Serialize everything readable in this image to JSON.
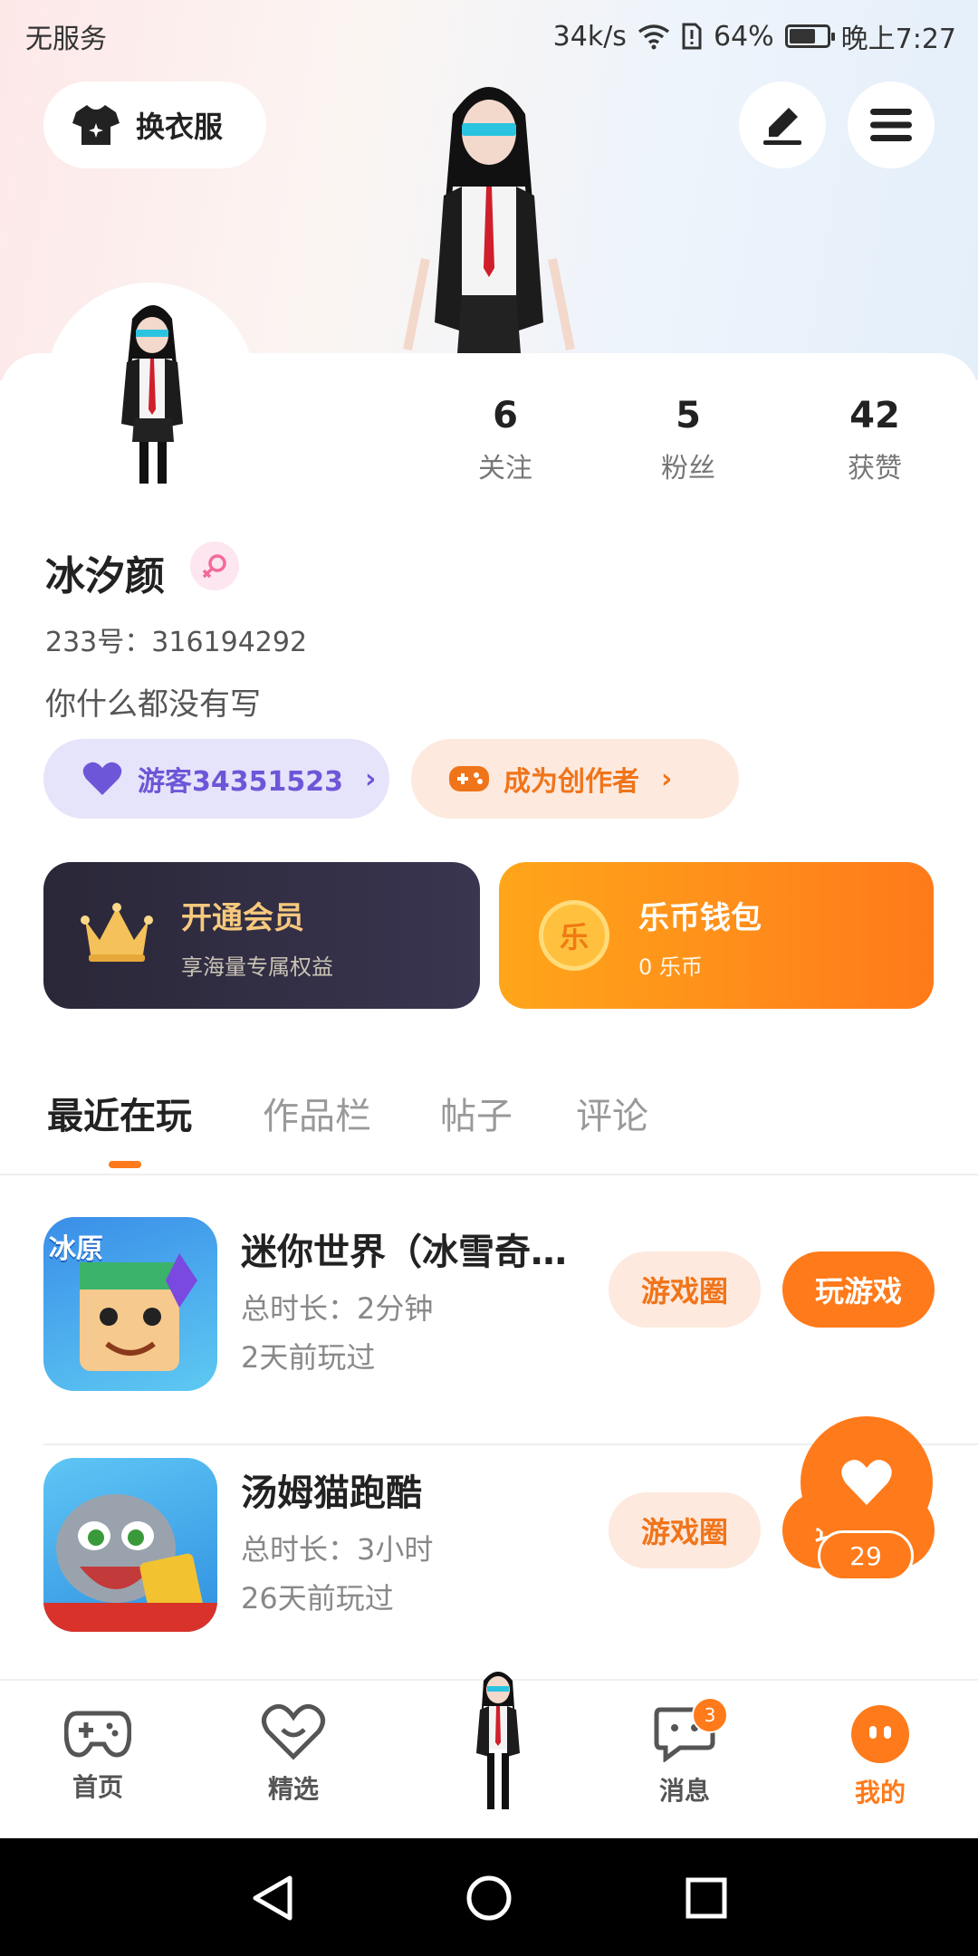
{
  "status_bar": {
    "carrier": "无服务",
    "net_speed": "34k/s",
    "battery_percent": "64%",
    "time": "晚上7:27"
  },
  "header": {
    "dress_button_label": "换衣服",
    "icons": [
      "shirt-icon",
      "edit-icon",
      "menu-icon"
    ]
  },
  "profile": {
    "stats": [
      {
        "value": "6",
        "label": "关注"
      },
      {
        "value": "5",
        "label": "粉丝"
      },
      {
        "value": "42",
        "label": "获赞"
      }
    ],
    "name": "冰汐颜",
    "gender": "female",
    "id_label": "233号：",
    "id_value": "316194292",
    "bio": "你什么都没有写",
    "visitor_chip": "游客34351523",
    "creator_chip": "成为创作者"
  },
  "cards": {
    "vip": {
      "title": "开通会员",
      "subtitle": "享海量专属权益"
    },
    "wallet": {
      "title": "乐币钱包",
      "subtitle": "0 乐币",
      "coin_char": "乐"
    }
  },
  "tabs": [
    "最近在玩",
    "作品栏",
    "帖子",
    "评论"
  ],
  "games": [
    {
      "title": "迷你世界（冰雪奇…",
      "duration": "总时长：2分钟",
      "last_played": "2天前玩过",
      "icon_label": "冰原",
      "circle_label": "游戏圈",
      "play_label": "玩游戏"
    },
    {
      "title": "汤姆猫跑酷",
      "duration": "总时长：3小时",
      "last_played": "26天前玩过",
      "circle_label": "游戏圈",
      "play_label": "玩游戏"
    }
  ],
  "floating_like": {
    "count": "29"
  },
  "bottom_nav": [
    {
      "label": "首页",
      "icon": "gamepad-icon"
    },
    {
      "label": "精选",
      "icon": "heart-icon"
    },
    {
      "label": "消息",
      "icon": "chat-icon",
      "badge": "3"
    },
    {
      "label": "我的",
      "icon": "profile-icon",
      "active": true
    }
  ],
  "colors": {
    "accent": "#ff7a1a",
    "visitor": "#6e56d8",
    "vip_dark": "#2a2738"
  }
}
